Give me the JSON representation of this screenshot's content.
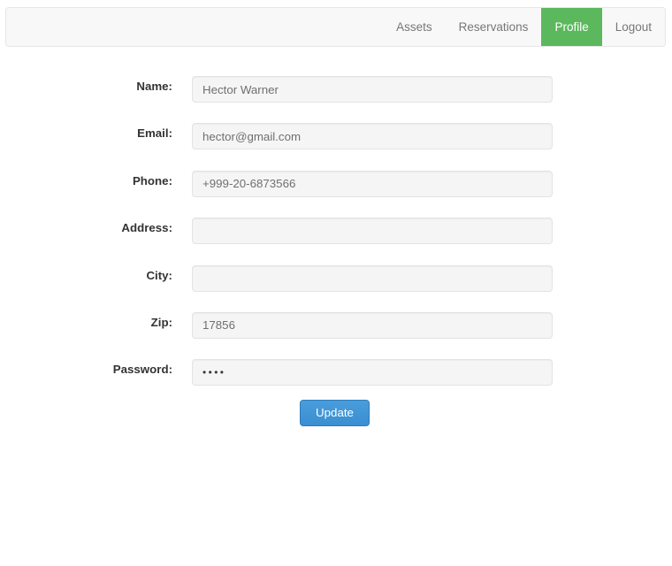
{
  "navbar": {
    "items": [
      {
        "label": "Assets",
        "active": false
      },
      {
        "label": "Reservations",
        "active": false
      },
      {
        "label": "Profile",
        "active": true
      },
      {
        "label": "Logout",
        "active": false
      }
    ],
    "active_color": "#5cb85c",
    "background": "#f8f8f8"
  },
  "form": {
    "fields": [
      {
        "label": "Name:",
        "value": "Hector Warner",
        "placeholder": "",
        "type": "text"
      },
      {
        "label": "Email:",
        "value": "hector@gmail.com",
        "placeholder": "",
        "type": "text"
      },
      {
        "label": "Phone:",
        "value": "+999-20-6873566",
        "placeholder": "",
        "type": "text"
      },
      {
        "label": "Address:",
        "value": "",
        "placeholder": "",
        "type": "text"
      },
      {
        "label": "City:",
        "value": "",
        "placeholder": "",
        "type": "text"
      },
      {
        "label": "Zip:",
        "value": "17856",
        "placeholder": "",
        "type": "text"
      },
      {
        "label": "Password:",
        "value": "••••",
        "placeholder": "",
        "type": "password"
      }
    ],
    "submit_label": "Update",
    "submit_color": "#3c92d4"
  }
}
